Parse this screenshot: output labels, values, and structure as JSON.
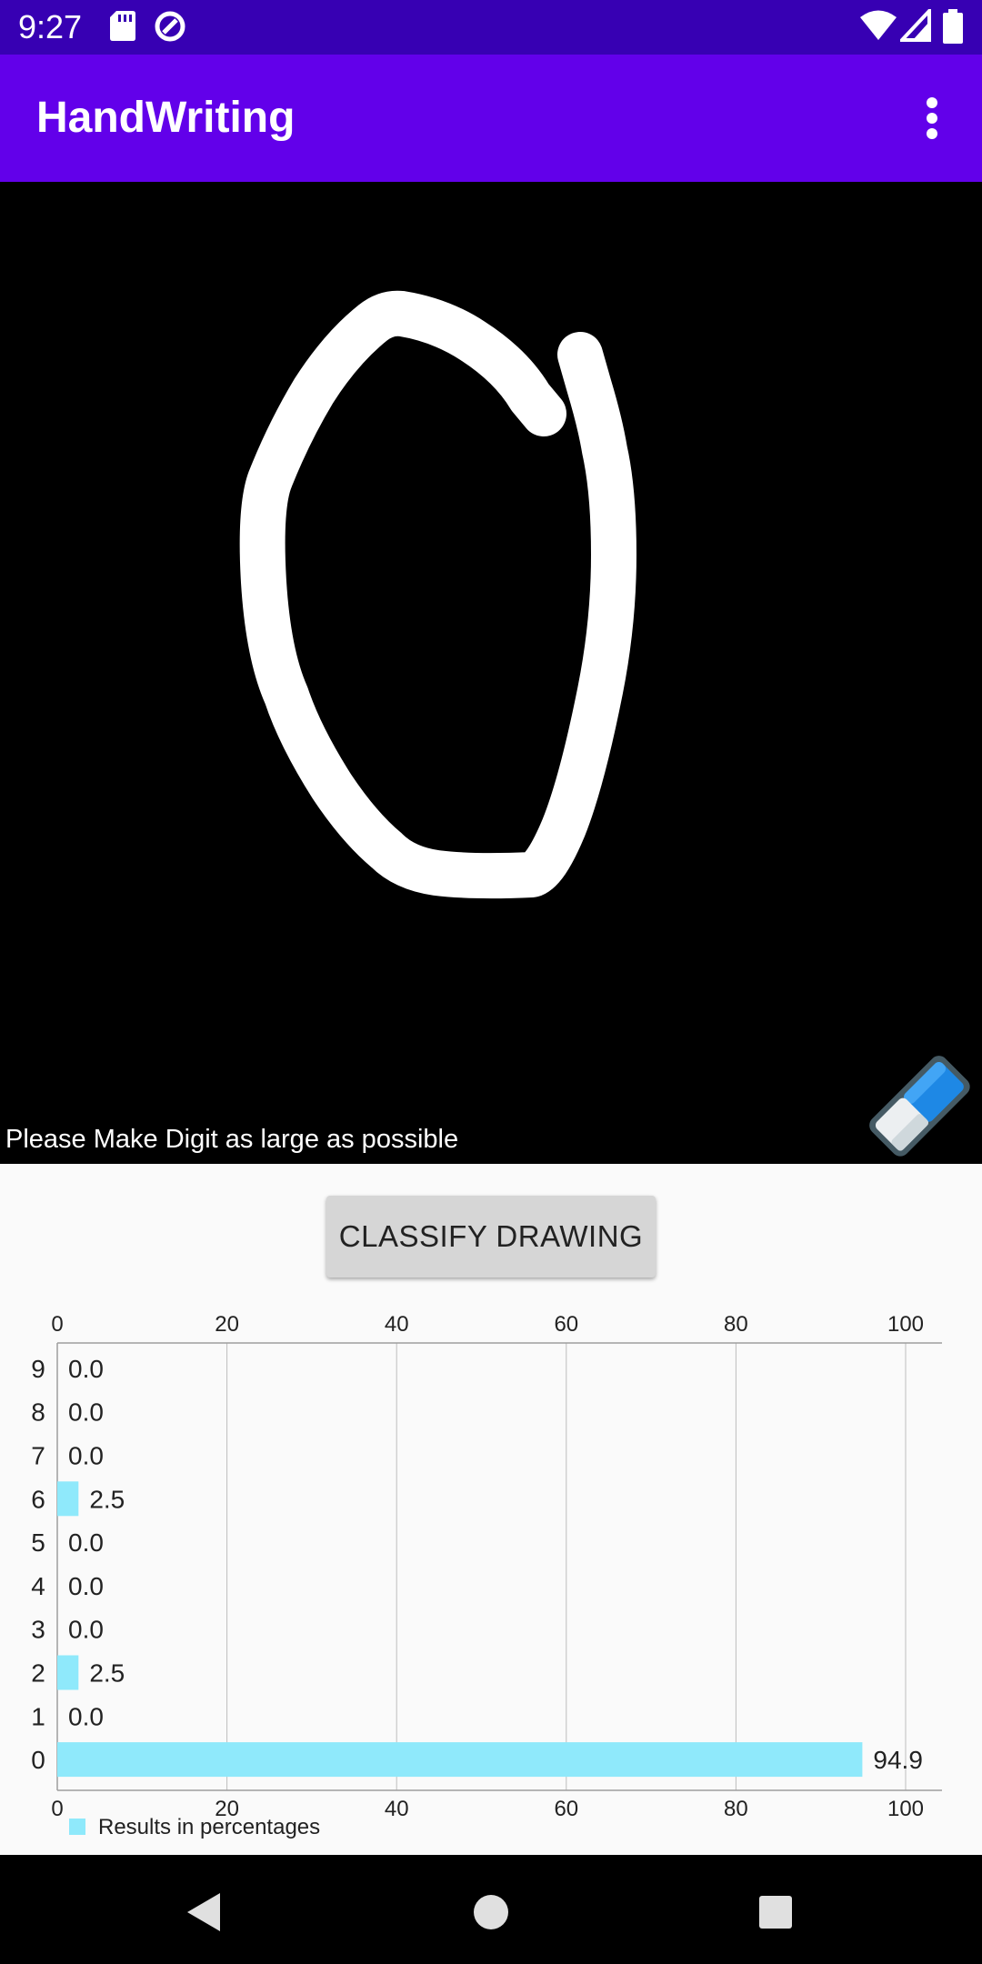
{
  "status_bar": {
    "time": "9:27",
    "icons": [
      "sd-card-icon",
      "sync-icon",
      "wifi-icon",
      "signal-icon",
      "battery-icon"
    ]
  },
  "app_bar": {
    "title": "HandWriting",
    "menu_icon": "more-vert-icon"
  },
  "canvas": {
    "hint": "Please Make Digit as large as possible",
    "eraser_icon": "eraser-icon"
  },
  "classify_button": {
    "label": "CLASSIFY DRAWING"
  },
  "chart_data": {
    "type": "bar",
    "orientation": "horizontal",
    "categories": [
      "0",
      "1",
      "2",
      "3",
      "4",
      "5",
      "6",
      "7",
      "8",
      "9"
    ],
    "series": [
      {
        "name": "Results in percentages",
        "values": [
          94.9,
          0.0,
          2.5,
          0.0,
          0.0,
          0.0,
          2.5,
          0.0,
          0.0,
          0.0
        ]
      }
    ],
    "value_labels": [
      "94.9",
      "0.0",
      "2.5",
      "0.0",
      "0.0",
      "0.0",
      "2.5",
      "0.0",
      "0.0",
      "0.0"
    ],
    "xlim": [
      0,
      100
    ],
    "xticks": [
      "0",
      "20",
      "40",
      "60",
      "80",
      "100"
    ],
    "grid": true,
    "legend": "bottom-left",
    "bar_color": "#8fe9fb"
  },
  "nav_bar": {
    "back_icon": "back-icon",
    "home_icon": "home-icon",
    "recents_icon": "recents-icon"
  },
  "colors": {
    "status_bar": "#3700b3",
    "app_bar": "#6200ea",
    "canvas": "#000000",
    "ink": "#ffffff"
  }
}
